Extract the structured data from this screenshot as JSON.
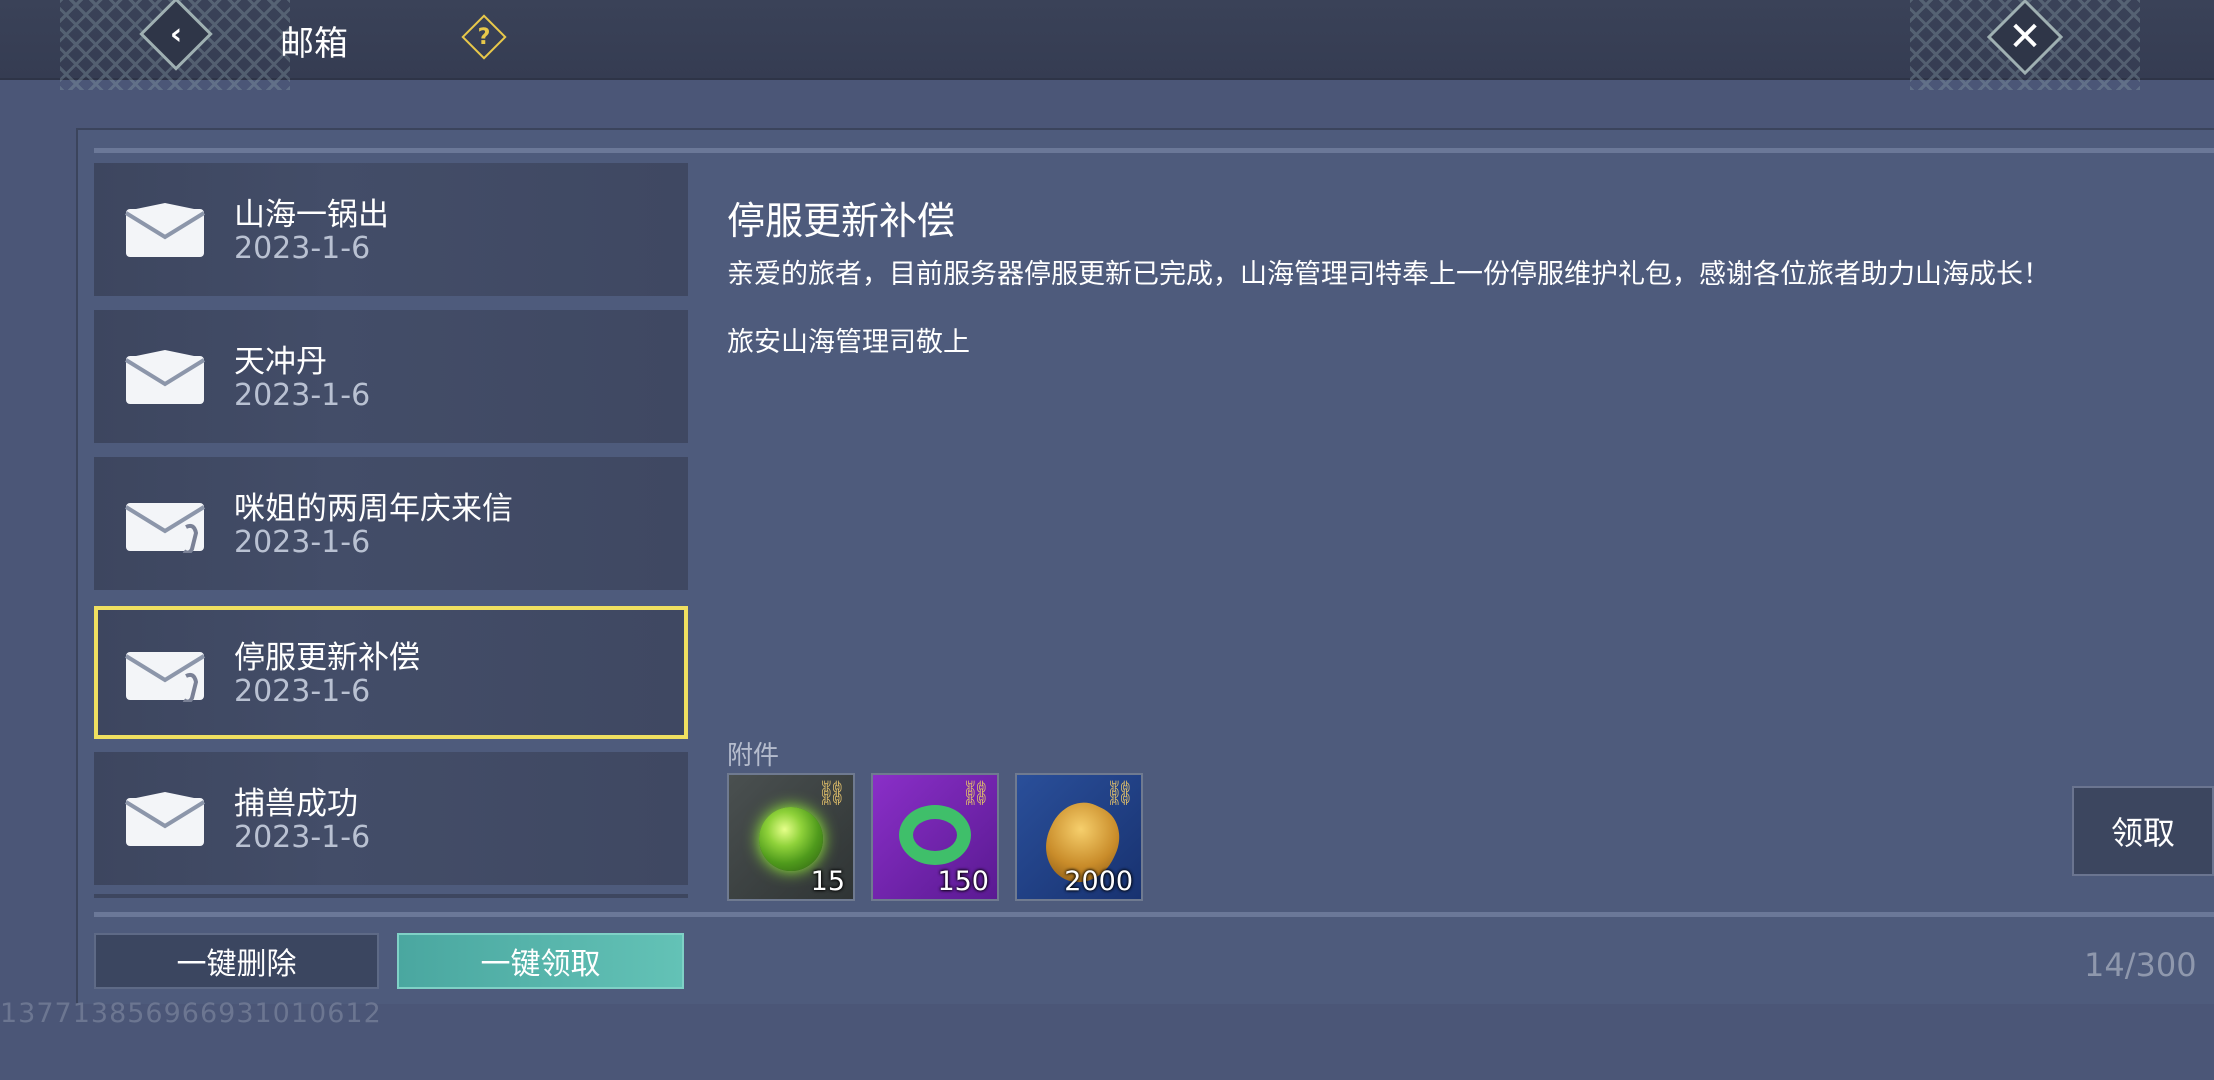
{
  "header": {
    "title": "邮箱",
    "help_glyph": "?",
    "back_glyph": "‹",
    "close_glyph": "✕"
  },
  "mail_list": [
    {
      "title": "山海一锅出",
      "date": "2023-1-6",
      "has_attachment": false,
      "selected": false
    },
    {
      "title": "天冲丹",
      "date": "2023-1-6",
      "has_attachment": false,
      "selected": false
    },
    {
      "title": "咪姐的两周年庆来信",
      "date": "2023-1-6",
      "has_attachment": true,
      "selected": false
    },
    {
      "title": "停服更新补偿",
      "date": "2023-1-6",
      "has_attachment": true,
      "selected": true
    },
    {
      "title": "捕兽成功",
      "date": "2023-1-6",
      "has_attachment": false,
      "selected": false
    }
  ],
  "mail_detail": {
    "heading": "停服更新补偿",
    "body": "亲爱的旅者，目前服务器停服更新已完成，山海管理司特奉上一份停服维护礼包，感谢各位旅者助力山海成长！",
    "signature": "旅安山海管理司敬上",
    "attachments_label": "附件",
    "attachments": [
      {
        "icon": "green-orb-icon",
        "qty": "15"
      },
      {
        "icon": "jade-ring-icon",
        "qty": "150"
      },
      {
        "icon": "gold-shell-icon",
        "qty": "2000"
      }
    ],
    "claim_label": "领取"
  },
  "footer": {
    "delete_all_label": "一键删除",
    "claim_all_label": "一键领取",
    "mail_count": "14/300",
    "uid": "13771385696693101061​2"
  },
  "colors": {
    "selected_border": "#f0e060",
    "claim_all_bg": "#5ab8ad",
    "panel_bg": "#4e5b7c"
  }
}
